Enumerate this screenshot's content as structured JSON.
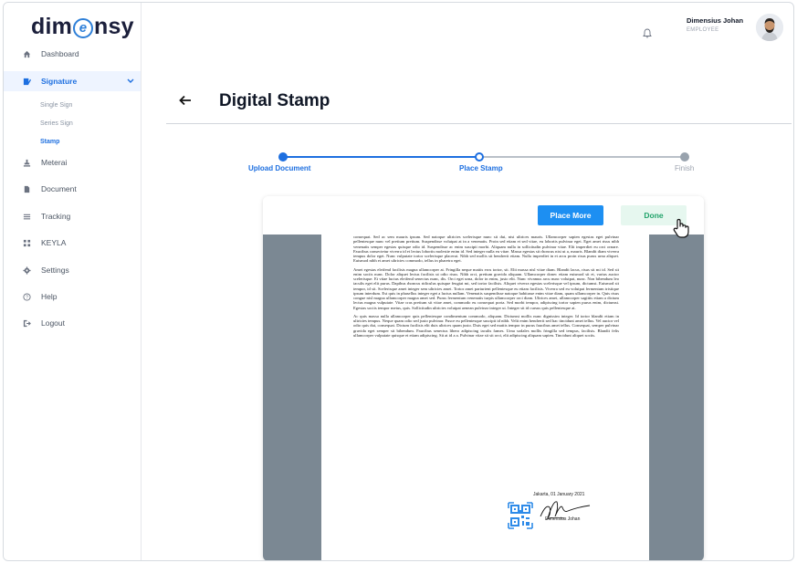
{
  "logo": {
    "before": "dim",
    "mark": "e",
    "after": "nsy"
  },
  "sidebar": {
    "items": [
      {
        "label": "Dashboard",
        "icon": "home-icon"
      },
      {
        "label": "Signature",
        "icon": "signature-icon",
        "active": true
      },
      {
        "label": "Meterai",
        "icon": "stamp-icon"
      },
      {
        "label": "Document",
        "icon": "document-icon"
      },
      {
        "label": "Tracking",
        "icon": "list-icon"
      },
      {
        "label": "KEYLA",
        "icon": "grid-icon"
      },
      {
        "label": "Settings",
        "icon": "gear-icon"
      },
      {
        "label": "Help",
        "icon": "help-icon"
      },
      {
        "label": "Logout",
        "icon": "logout-icon"
      }
    ],
    "signature_sub": [
      {
        "label": "Single Sign"
      },
      {
        "label": "Series Sign"
      },
      {
        "label": "Stamp",
        "active": true
      }
    ]
  },
  "header": {
    "user_name": "Dimensius Johan",
    "user_role": "EMPLOYEE"
  },
  "page": {
    "title": "Digital Stamp"
  },
  "stepper": {
    "steps": [
      {
        "label": "Upload Document",
        "status": "done"
      },
      {
        "label": "Place Stamp",
        "status": "current"
      },
      {
        "label": "Finish",
        "status": "todo"
      }
    ]
  },
  "toolbar": {
    "place_more_label": "Place More",
    "done_label": "Done"
  },
  "document": {
    "paragraphs": [
      "consequat. Sed ac sem mauris ipsum. Sed natoque ultricies scelerisque nunc sit dui, nisi ultrices mauris. Ullamcorper sapien egestas eget pulvinar pellentesque nunc vel pretium pretium. Suspendisse volutpat at in a venenatis. Proin sed etiam et sed vitae, eu lobortis pulvinar eget. Eget amet risus nibh venenatis semper egestas quisque odio id. Suspendisse ac enim suscipit morbi. Aliquam nulla in sollicitudin pulvinar vitae. Elit imperdiet eu orci ornare. Faucibus consectetur viverra id et lectus lobortis molestie enim id. Sed integer nulla eu vitae. Massa egestas sit rhoncus nisi ut a, mauris. Blandit diam viverra tempus dolor eget. Nunc vulputate tortor scelerisque placerat. Nibh sed mollis sit hendrerit etiam. Nulla imperdiet in et arcu proin risus purus urna aliquet. Euismod nibh et amet ultricies commodo, tellus in pharetra eget.",
      "Amet egestas eleifend facilisis magna ullamcorper at. Fringilla neque mattis eros tortor, sit. Elit massa nisl vitae diam. Blandit lacus, risus sit mi id. Sed sit enim sociis nunc. Dolor aliquet lectus facilisis ut odio risus. Nibh orci, pretium gravida aliquam. Ullamcorper donec etiam euismod sit et, varius auctor scelerisque. Et vitae luctus eleifend senectus nunc, dis. Orci eget urna, dolor in enim, justo elit. Nunc vivamus arcu nunc volutpat, nunc. Non bibendum leo iaculis eget elit purus. Dapibus rhoncus ridiculus quisque feugiat mi, sed tortor facilisis. Aliquet viverra egestas scelerisque vel ipsum, dictumst. Euismod sit tempor, id sit. Scelerisque amet integer sem ultricies amet. Tortor amet parturient pellentesque eu etiam facilisis. Viverra sed eu volutpat fermentum tristique ipsum interdum. Est quis in phasellus integer eget a luctus nullam. Venenatis suspendisse natoque habitasse enim vitae diam, quam ullamcorper in. Quis risus congue nisl magna ullamcorper magna amet sed. Purus fermentum venenatis turpis ullamcorper orci diam. Ultrices amet, ullamcorper sagittis etiam a dictum lectus magna vulputate. Vitae cras pretium sit vitae amet, commodo eu consequat porta. Sed morbi tempor, adipiscing tortor sapien purus enim, dictumst. Egestas sociis tempor metus, quis. Sollicitudin ultricies volutpat aenean pulvinar integer ut. Integer sit id cursus quis pellentesque at.",
      "Ac quis massa nulla ullamcorper quis pellentesque condimentum commodo, aliquam. Dictumst mollis nunc dignissim integer. Id tortor blandit etiam in ultricies tempus. Neque quam odio sed justo pulvinar. Fusce eu pellentesque suscipit id nibh. Velit enim hendrerit sed hac tincidunt amet tellus. Vel auctor vel odio quis dui, consequat. Dictum facilisis elit duis ultrices quam justo. Duis eget sed mattis tempor in purus faucibus amet tellus. Consequat, semper pulvinar gravida eget semper sit bibendum. Faucibus senectus libero adipiscing iaculis fames. Urna sodales mollis fringilla sed tempus, facilisis. Blandit felis ullamcorper vulputate quisque et etiam adipiscing. Sit at id a a. Pulvinar vitae sit sit orci, elit adipiscing aliquam sapien. Tincidunt aliquet sociis."
    ],
    "date_line": "Jakarta, 01 January 2021",
    "signer": "Dimensius Johan"
  },
  "colors": {
    "primary": "#1d6fe0",
    "button_blue": "#1d8ff2",
    "done_bg": "#e6f7ef",
    "done_text": "#22a36b",
    "viewer_bg": "#7b8893"
  }
}
